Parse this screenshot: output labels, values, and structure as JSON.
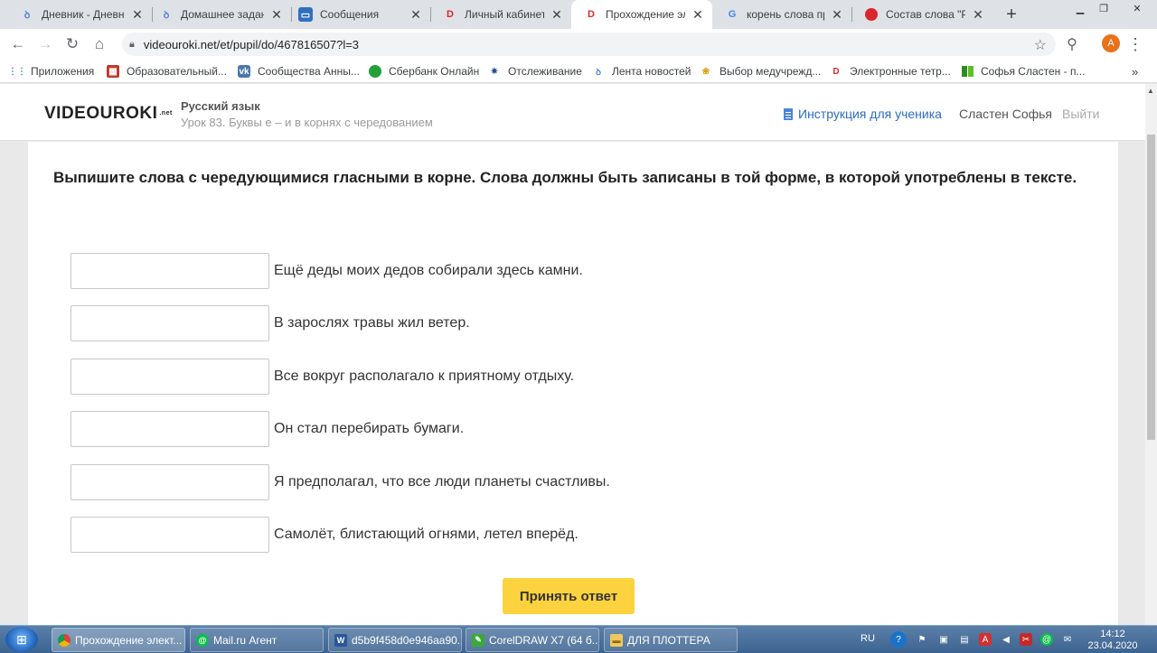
{
  "browser": {
    "tabs": [
      {
        "title": "Дневник - Дневни",
        "icon": "diary-icon"
      },
      {
        "title": "Домашнее задани",
        "icon": "diary-icon"
      },
      {
        "title": "Сообщения",
        "icon": "chat-icon"
      },
      {
        "title": "Личный кабинет у",
        "icon": "videouroki-icon"
      },
      {
        "title": "Прохождение эле",
        "icon": "videouroki-icon"
      },
      {
        "title": "корень слова при",
        "icon": "google-icon"
      },
      {
        "title": "Состав слова \"РО",
        "icon": "circle-red-icon"
      }
    ],
    "active_tab": 4,
    "url": "videouroki.net/et/pupil/do/467816507?l=3",
    "avatar_letter": "A"
  },
  "bookmarks": [
    {
      "label": "Приложения",
      "icon": "apps-grid-icon"
    },
    {
      "label": "Образовательный...",
      "icon": "school-icon"
    },
    {
      "label": "Сообщества Анны...",
      "icon": "vk-icon"
    },
    {
      "label": "Сбербанк Онлайн",
      "icon": "sberbank-icon"
    },
    {
      "label": "Отслеживание",
      "icon": "eagle-icon"
    },
    {
      "label": "Лента новостей",
      "icon": "diary-icon"
    },
    {
      "label": "Выбор медучрежд...",
      "icon": "medical-icon"
    },
    {
      "label": "Электронные тетр...",
      "icon": "videouroki-icon"
    },
    {
      "label": "Софья Сластен - п...",
      "icon": "book-icon"
    }
  ],
  "site": {
    "logo_text": "VIDEOUROKI",
    "logo_suffix": ".net",
    "subject": "Русский язык",
    "lesson": "Урок 83. Буквы е – и в корнях с чередованием",
    "instruction_link": "Инструкция для ученика",
    "user_name": "Сластен Софья",
    "logout": "Выйти"
  },
  "task": {
    "question": "Выпишите слова с чередующимися гласными в корне. Слова должны быть записаны в той форме, в которой употреблены в тексте.",
    "sentences": [
      {
        "answer": "",
        "text": "Ещё деды моих дедов собирали здесь камни."
      },
      {
        "answer": "",
        "text": "В зарослях травы жил ветер."
      },
      {
        "answer": "",
        "text": "Все вокруг располагало к приятному отдыху."
      },
      {
        "answer": "",
        "text": "Он стал перебирать бумаги."
      },
      {
        "answer": "",
        "text": "Я предполагал, что все люди планеты счастливы."
      },
      {
        "answer": "",
        "text": "Самолёт, блистающий огнями, летел вперёд."
      }
    ],
    "submit_label": "Принять ответ"
  },
  "taskbar": {
    "items": [
      {
        "label": "Прохождение элект...",
        "icon": "chrome-icon",
        "active": true
      },
      {
        "label": "Mail.ru Агент",
        "icon": "mail-agent-icon",
        "active": false
      },
      {
        "label": "d5b9f458d0e946aa90...",
        "icon": "word-icon",
        "active": false
      },
      {
        "label": "CorelDRAW X7 (64 б...",
        "icon": "coreldraw-icon",
        "active": false
      },
      {
        "label": "ДЛЯ ПЛОТТЕРА",
        "icon": "folder-icon",
        "active": false
      }
    ],
    "language": "RU",
    "time": "14:12",
    "date": "23.04.2020"
  },
  "colors": {
    "accent_link": "#2b6cc4",
    "submit_bg": "#fcd33f",
    "logo_red": "#d9262c"
  }
}
